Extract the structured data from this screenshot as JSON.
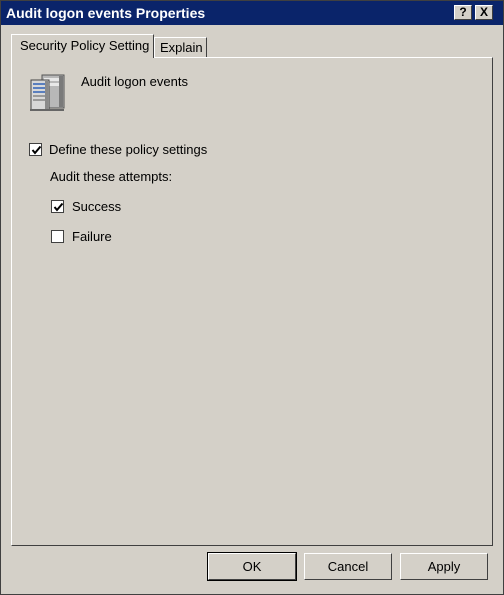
{
  "window": {
    "title": "Audit logon events Properties",
    "help_button": "?",
    "close_button": "X"
  },
  "tabs": [
    {
      "label": "Security Policy Setting",
      "active": true
    },
    {
      "label": "Explain",
      "active": false
    }
  ],
  "policy": {
    "icon": "server-policy-icon",
    "name": "Audit logon events"
  },
  "settings": {
    "define_label": "Define these policy settings",
    "define_checked": true,
    "audit_label": "Audit these attempts:",
    "success_label": "Success",
    "success_checked": true,
    "failure_label": "Failure",
    "failure_checked": false
  },
  "buttons": {
    "ok": "OK",
    "cancel": "Cancel",
    "apply": "Apply"
  },
  "colors": {
    "titlebar": "#0a246a",
    "dialog_face": "#d4d0c8"
  }
}
